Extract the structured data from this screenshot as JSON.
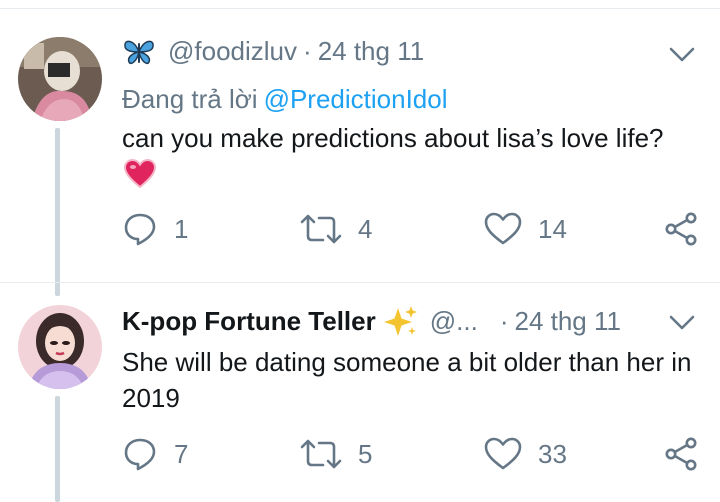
{
  "tweets": [
    {
      "handle": "@foodizluv",
      "separator": "·",
      "time": "24 thg 11",
      "reply_prefix": "Đang trả lời",
      "reply_to": "@PredictionIdol",
      "text": "can you make predictions about lisa’s love life?",
      "name_emoji": "butterfly-icon",
      "body_emoji": "heart-emoji",
      "counts": {
        "replies": "1",
        "retweets": "4",
        "likes": "14"
      }
    },
    {
      "display_name": "K-pop Fortune Teller",
      "handle": "@...",
      "separator": "·",
      "time": "24 thg 11",
      "text": "She will be dating someone a bit older than her in 2019",
      "name_emoji": "sparkles-icon",
      "counts": {
        "replies": "7",
        "retweets": "5",
        "likes": "33"
      }
    }
  ],
  "colors": {
    "text_primary": "#14171a",
    "text_secondary": "#657786",
    "link": "#1da1f2",
    "divider": "#e6ecf0",
    "thread_line": "#ccd6dd"
  }
}
